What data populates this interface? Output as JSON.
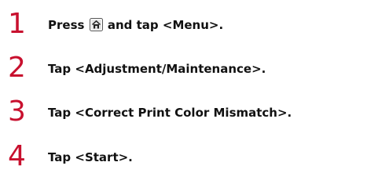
{
  "steps": [
    {
      "number": "1",
      "text_before": "Press ",
      "icon": "home-icon",
      "text_after": " and tap <Menu>."
    },
    {
      "number": "2",
      "text": "Tap <Adjustment/Maintenance>."
    },
    {
      "number": "3",
      "text": "Tap <Correct Print Color Mismatch>."
    },
    {
      "number": "4",
      "text": "Tap <Start>."
    }
  ],
  "colors": {
    "step_number": "#c8102e",
    "text": "#111111"
  }
}
